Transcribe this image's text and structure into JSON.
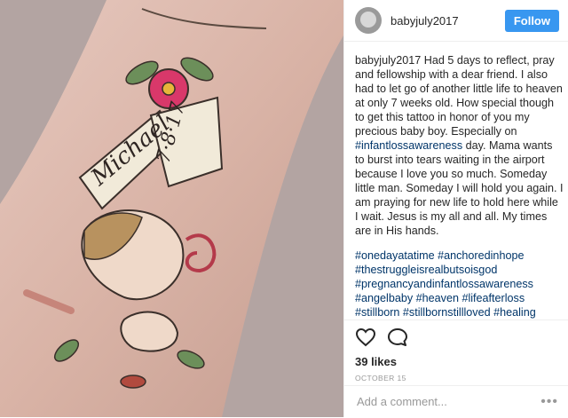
{
  "post": {
    "username": "babyjuly2017",
    "follow_label": "Follow",
    "caption_text": "Had 5 days to reflect, pray and fellowship with a dear friend. I also had to let go of another little life to heaven at only 7 weeks old. How special though to get this tattoo in honor of you my precious baby boy. Especially on",
    "caption_tag": "#infantlossawareness",
    "caption_text2": "day. Mama wants to burst into tears waiting in the airport because I love you so much. Someday little man. Someday I will hold you again. I am praying for new life to hold here while I wait. Jesus is my all and all. My times are in His hands.",
    "hashtags": "#onedayatatime #anchoredinhope #thestruggleisrealbutsoisgod #pregnancyandinfantlossawareness #angelbaby #heaven #lifeafterloss #stillborn #stillbornstillloved #healing #godisgreat #stillborn",
    "likes": "39 likes",
    "date": "OCTOBER 15",
    "comment_placeholder": "Add a comment...",
    "more_label": "•••"
  },
  "tattoo": {
    "name": "Michael",
    "date": "7·8·17"
  },
  "icons": {
    "heart": "heart-icon",
    "comment": "comment-icon"
  },
  "colors": {
    "follow": "#3897f0",
    "hashtag": "#003569",
    "muted": "#999999"
  }
}
